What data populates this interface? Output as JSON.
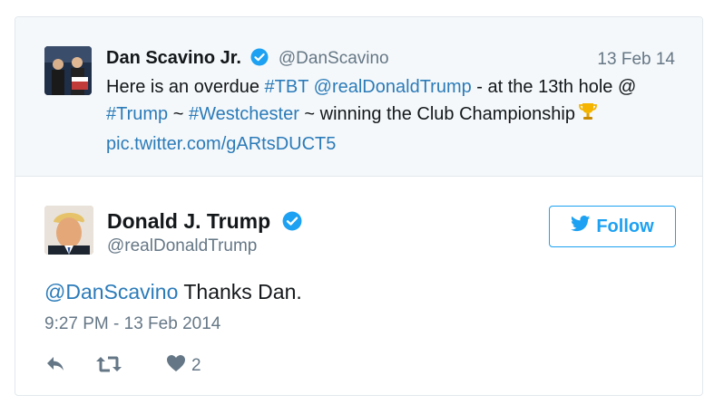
{
  "quoted_tweet": {
    "author_name": "Dan Scavino Jr.",
    "handle": "@DanScavino",
    "date": "13 Feb 14",
    "text_prefix": "Here is an overdue ",
    "hashtag_tbt": "#TBT",
    "mention": "@realDonaldTrump",
    "text_middle": " - at the 13th hole @",
    "hashtag_trump": "#Trump",
    "tilde1": " ~ ",
    "hashtag_westchester": "#Westchester",
    "text_suffix": " ~ winning the Club Championship",
    "pic_link": "pic.twitter.com/gARtsDUCT5",
    "emoji_icon": "trophy-icon"
  },
  "tweet": {
    "author_name": "Donald J. Trump",
    "handle": "@realDonaldTrump",
    "follow_label": "Follow",
    "reply_mention": "@DanScavino",
    "text": " Thanks Dan.",
    "timestamp": "9:27 PM - 13 Feb 2014",
    "like_count": "2"
  },
  "colors": {
    "link": "#2b7bb9",
    "follow_blue": "#1da1f2",
    "muted": "#657786",
    "quote_bg": "#f5f8fa",
    "verified": "#1da1f2"
  },
  "icons": [
    "verified-badge-icon",
    "twitter-bird-icon",
    "reply-icon",
    "retweet-icon",
    "heart-icon",
    "trophy-icon"
  ]
}
